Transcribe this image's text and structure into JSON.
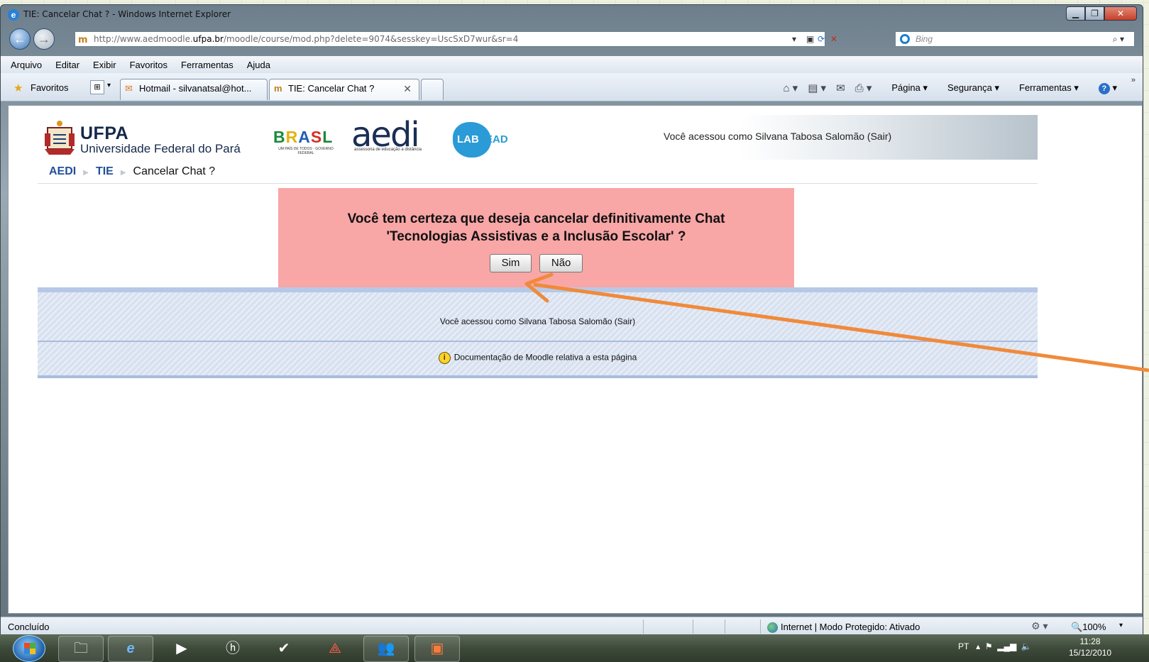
{
  "window": {
    "title": "TIE: Cancelar Chat ? - Windows Internet Explorer",
    "url_prefix": "http://www.aedmoodle.",
    "url_domain": "ufpa.br",
    "url_suffix": "/moodle/course/mod.php?delete=9074&sesskey=UscSxD7wur&sr=4",
    "search_placeholder": "Bing"
  },
  "menu": [
    "Arquivo",
    "Editar",
    "Exibir",
    "Favoritos",
    "Ferramentas",
    "Ajuda"
  ],
  "favorites_bar": {
    "favorites_label": "Favoritos",
    "tabs": [
      {
        "label": "Hotmail - silvanatsal@hot...",
        "icon": "mail-icon"
      },
      {
        "label": "TIE: Cancelar Chat ?",
        "icon": "moodle-icon",
        "active": true
      }
    ],
    "commands": {
      "page": "Página",
      "security": "Segurança",
      "tools": "Ferramentas"
    }
  },
  "site": {
    "ufpa_short": "UFPA",
    "ufpa_full": "Universidade Federal do Pará",
    "brasil_logo": "BRASIL",
    "brasil_sub": "UM PAÍS DE TODOS · GOVERNO FEDERAL",
    "aedi_logo": "aedi",
    "aedi_sub": "assessoria de educação a distância",
    "labead_lab": "LAB",
    "labead_ead": "EAD",
    "login_info": "Você acessou como Silvana Tabosa Salomão (Sair)"
  },
  "breadcrumb": {
    "items": [
      "AEDI",
      "TIE"
    ],
    "current": "Cancelar Chat ?"
  },
  "confirm": {
    "line1": "Você tem certeza que deseja cancelar definitivamente Chat",
    "line2": "'Tecnologias Assistivas e a Inclusão Escolar' ?",
    "yes_label": "Sim",
    "no_label": "Não"
  },
  "footer": {
    "login_info": "Você acessou como Silvana Tabosa Salomão (Sair)",
    "doc_link": "Documentação de Moodle relativa a esta página"
  },
  "statusbar": {
    "status": "Concluído",
    "zone": "Internet | Modo Protegido: Ativado",
    "zoom": "100%"
  },
  "taskbar": {
    "lang": "PT",
    "time": "11:28",
    "date": "15/12/2010"
  },
  "colors": {
    "confirm_bg": "#f9a6a6",
    "arrow": "#f08a3a",
    "breadcrumb_link": "#22509a"
  }
}
